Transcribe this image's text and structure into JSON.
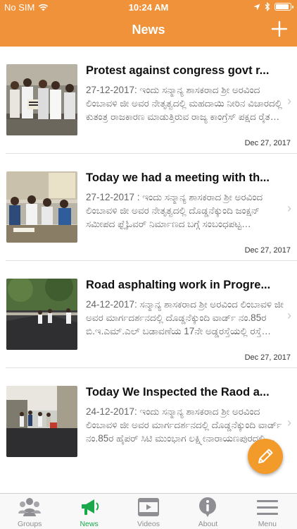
{
  "status": {
    "carrier": "No SIM",
    "time": "10:24 AM"
  },
  "header": {
    "title": "News"
  },
  "news": [
    {
      "title": "Protest against congress govt r...",
      "desc": "27-12-2017: ಇಂದು ಸನ್ಮಾನ್ಯ ಶಾಸಕರಾದ ಶ್ರೀ ಅರವಿಂದ ಲಿಂಬಾವಳಿ ಜೀ ಅವರ ನೇತೃತ್ವದಲ್ಲಿ ಮಹದಾಯಿ ನೀರಿನ ವಿಚಾರದಲ್ಲಿ ಕುತಂತ್ರ ರಾಜಕಾರಣ ಮಾಡುತ್ತಿರುವ ರಾಜ್ಯ ಕಾಂಗ್ರೆಸ್ ಪಕ್ಷದ ರೈತ ವಿರೋಧಿ...",
      "date": "Dec 27, 2017"
    },
    {
      "title": "Today we had a meeting with th...",
      "desc": "27-12-2017 : ಇಂದು ಸನ್ಮಾನ್ಯ ಶಾಸಕರಾದ ಶ್ರೀ ಅರವಿಂದ ಲಿಂಬಾವಳಿ ಜೀ ಅವರ ನೇತೃತ್ವದಲ್ಲಿ ದೊಡ್ಡನೆಕ್ಕುಂದಿ ಜಂಕ್ಷನ್ ಸಮೀಪದ ಫ್ಲೈಓವರ್ ನಿರ್ಮಾಣದ ಬಗ್ಗೆ ಸಂಬಂಧಪಟ್ಟ ಅಧಿಕಾರಿಗಳೊಂದಿಗೆ ಸಭೆಯಲ್ಲಿ...",
      "date": "Dec 27, 2017"
    },
    {
      "title": "Road asphalting work in Progre...",
      "desc": "24-12-2017: ಸನ್ಮಾನ್ಯ ಶಾಸಕರಾದ ಶ್ರೀ ಅರವಿಂದ ಲಿಂಬಾವಳಿ ಜೀ ಅವರ ಮಾರ್ಗದರ್ಶನದಲ್ಲಿ ದೊಡ್ಡನೆಕ್ಕುಂದಿ ವಾರ್ಡ್ ನಂ.85ರ ಬಿ.ಇ.ಎಮ್.ಎಲ್ ಬಡಾವಣೆಯ 17ನೇ ಅಡ್ಡರಸ್ತೆಯಲ್ಲಿ ರಸ್ತೆ ಡಾಂಬರೀಕರ...",
      "date": "Dec 27, 2017"
    },
    {
      "title": "Today We Inspected the Raod a...",
      "desc": "24-12-2017: ಇಂದು ಸನ್ಮಾನ್ಯ ಶಾಸಕರಾದ ಶ್ರೀ ಅರವಿಂದ ಲಿಂಬಾವಳಿ ಜೀ ಅವರ ಮಾರ್ಗದರ್ಶನದಲ್ಲಿ ದೊಡ್ಡನೆಕ್ಕುಂದಿ ವಾರ್ಡ್ ನಂ.85ರ ಹೈಪರ್ ಸಿಟಿ ಮುಂಭಾಗ ಲಕ್ಷ್ಮೀನಾರಾಯಣಪುರದಲ್ಲಿ ಪ್ರಗತಿ...",
      "date": ""
    }
  ],
  "tabs": [
    {
      "label": "Groups",
      "icon": "groups-icon"
    },
    {
      "label": "News",
      "icon": "megaphone-icon"
    },
    {
      "label": "Videos",
      "icon": "videos-icon"
    },
    {
      "label": "About",
      "icon": "info-icon"
    },
    {
      "label": "Menu",
      "icon": "menu-icon"
    }
  ],
  "colors": {
    "header": "#f0923a",
    "active_tab": "#1aa94a",
    "fab": "#f39b2a"
  }
}
